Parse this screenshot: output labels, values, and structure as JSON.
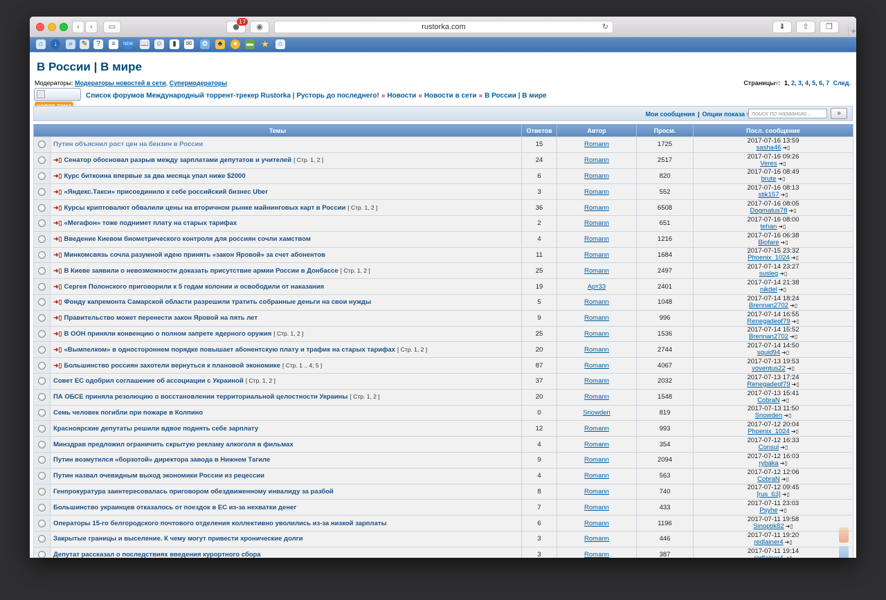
{
  "browser": {
    "url": "rustorka.com",
    "adblock_badge": "17"
  },
  "page": {
    "heading": "В России | В мире",
    "moderators_label": "Модераторы:",
    "moderators": [
      "Модераторы новостей в сети",
      "Супермодераторы"
    ],
    "pages_label": "Страницы",
    "pages": [
      "1",
      "2",
      "3",
      "4",
      "5",
      "6",
      "7"
    ],
    "pages_next": "След.",
    "new_topic_label": "новая тема",
    "breadcrumbs": [
      "Список форумов Международный торрент-трекер Rustorka | Русторь до последнего!",
      "Новости",
      "Новости в сети",
      "В России | В мире"
    ],
    "my_posts": "Мои сообщения",
    "view_options": "Опции показа",
    "search_placeholder": "поиск по названию...",
    "search_go": "»"
  },
  "table": {
    "headers": [
      "Темы",
      "Ответов",
      "Автор",
      "Просм.",
      "Посл. сообщение"
    ],
    "rows": [
      {
        "title": "Путин объяснил рост цен на бензин в России",
        "new": false,
        "read": true,
        "pages": "",
        "replies": "15",
        "author": "Romann",
        "views": "1725",
        "last_time": "2017-07-16 13:59",
        "last_user": "sasha46"
      },
      {
        "title": "Сенатор обосновал разрыв между зарплатами депутатов и учителей",
        "new": true,
        "read": false,
        "pages": "[ Стр. 1, 2 ]",
        "replies": "24",
        "author": "Romann",
        "views": "2517",
        "last_time": "2017-07-16 09:26",
        "last_user": "Veres"
      },
      {
        "title": "Курс биткоина впервые за два месяца упал ниже $2000",
        "new": true,
        "read": false,
        "pages": "",
        "replies": "6",
        "author": "Romann",
        "views": "820",
        "last_time": "2017-07-16 08:49",
        "last_user": "brute"
      },
      {
        "title": "«Яндекс.Такси» присоединило к себе российский бизнес Uber",
        "new": true,
        "read": false,
        "pages": "",
        "replies": "3",
        "author": "Romann",
        "views": "552",
        "last_time": "2017-07-16 08:13",
        "last_user": "stik157"
      },
      {
        "title": "Курсы криптовалют обвалили цены на вторичном рынке майнинговых карт в России",
        "new": true,
        "read": false,
        "pages": "[ Стр. 1, 2 ]",
        "replies": "36",
        "author": "Romann",
        "views": "6508",
        "last_time": "2017-07-16 08:05",
        "last_user": "Dogmatus78"
      },
      {
        "title": "«Мегафон» тоже поднимет плату на старых тарифах",
        "new": true,
        "read": false,
        "pages": "",
        "replies": "2",
        "author": "Romann",
        "views": "651",
        "last_time": "2017-07-16 08:00",
        "last_user": "tehan"
      },
      {
        "title": "Введение Киевом биометрического контроля для россиян сочли хамством",
        "new": true,
        "read": false,
        "pages": "",
        "replies": "4",
        "author": "Romann",
        "views": "1216",
        "last_time": "2017-07-16 06:38",
        "last_user": "Biofare"
      },
      {
        "title": "Минкомсвязь сочла разумной идею принять «закон Яровой» за счет абонентов",
        "new": true,
        "read": false,
        "pages": "",
        "replies": "11",
        "author": "Romann",
        "views": "1684",
        "last_time": "2017-07-15 23:32",
        "last_user": "Phoenix_1024"
      },
      {
        "title": "В Киеве заявили о невозможности доказать присутствие армии России в Донбассе",
        "new": true,
        "read": false,
        "pages": "[ Стр. 1, 2 ]",
        "replies": "25",
        "author": "Romann",
        "views": "2497",
        "last_time": "2017-07-14 23:27",
        "last_user": "susleg"
      },
      {
        "title": "Сергея Полонского приговорили к 5 годам колонии и освободили от наказания",
        "new": true,
        "read": false,
        "pages": "",
        "replies": "19",
        "author": "Арт33",
        "views": "2401",
        "last_time": "2017-07-14 21:38",
        "last_user": "nikdel"
      },
      {
        "title": "Фонду капремонта Самарской области разрешили тратить собранные деньги на свои нужды",
        "new": true,
        "read": false,
        "pages": "",
        "replies": "5",
        "author": "Romann",
        "views": "1048",
        "last_time": "2017-07-14 18:24",
        "last_user": "Brennan2702"
      },
      {
        "title": "Правительство может перенести закон Яровой на пять лет",
        "new": true,
        "read": false,
        "pages": "",
        "replies": "9",
        "author": "Romann",
        "views": "996",
        "last_time": "2017-07-14 16:55",
        "last_user": "Renegadeof79"
      },
      {
        "title": "В ООН приняли конвенцию о полном запрете ядерного оружия",
        "new": true,
        "read": false,
        "pages": "[ Стр. 1, 2 ]",
        "replies": "25",
        "author": "Romann",
        "views": "1536",
        "last_time": "2017-07-14 15:52",
        "last_user": "Brennan2702"
      },
      {
        "title": "«Вымпелком» в одностороннем порядке повышает абонентскую плату и трафик на старых тарифах",
        "new": true,
        "read": false,
        "pages": "[ Стр. 1, 2 ]",
        "replies": "20",
        "author": "Romann",
        "views": "2744",
        "last_time": "2017-07-14 14:50",
        "last_user": "squid94"
      },
      {
        "title": "Большинство россиян захотели вернуться к плановой экономике",
        "new": true,
        "read": false,
        "pages": "[ Стр. 1 .. 4, 5 ]",
        "replies": "87",
        "author": "Romann",
        "views": "4067",
        "last_time": "2017-07-13 19:53",
        "last_user": "voventus22"
      },
      {
        "title": "Совет ЕС одобрил соглашение об ассоциации с Украиной",
        "new": false,
        "read": false,
        "pages": "[ Стр. 1, 2 ]",
        "replies": "37",
        "author": "Romann",
        "views": "2032",
        "last_time": "2017-07-13 17:24",
        "last_user": "Renegadeof79"
      },
      {
        "title": "ПА ОБСЕ приняла резолюцию о восстановлении территориальной целостности Украины",
        "new": false,
        "read": false,
        "pages": "[ Стр. 1, 2 ]",
        "replies": "20",
        "author": "Romann",
        "views": "1548",
        "last_time": "2017-07-13 15:41",
        "last_user": "CobraN"
      },
      {
        "title": "Семь человек погибли при пожаре в Колпино",
        "new": false,
        "read": false,
        "pages": "",
        "replies": "0",
        "author": "Snowden",
        "views": "819",
        "last_time": "2017-07-13 11:50",
        "last_user": "Snowden"
      },
      {
        "title": "Красноярские депутаты решили вдвое поднять себе зарплату",
        "new": false,
        "read": false,
        "pages": "",
        "replies": "12",
        "author": "Romann",
        "views": "993",
        "last_time": "2017-07-12 20:04",
        "last_user": "Phoenix_1024"
      },
      {
        "title": "Минздрав предложил ограничить скрытую рекламу алкоголя в фильмах",
        "new": false,
        "read": false,
        "pages": "",
        "replies": "4",
        "author": "Romann",
        "views": "354",
        "last_time": "2017-07-12 16:33",
        "last_user": "Consul"
      },
      {
        "title": "Путин возмутился «борзотой» директора завода в Нижнем Тагиле",
        "new": false,
        "read": false,
        "pages": "",
        "replies": "9",
        "author": "Romann",
        "views": "2094",
        "last_time": "2017-07-12 16:03",
        "last_user": "rybaka"
      },
      {
        "title": "Путин назвал очевидным выход экономики России из рецессии",
        "new": false,
        "read": false,
        "pages": "",
        "replies": "4",
        "author": "Romann",
        "views": "563",
        "last_time": "2017-07-12 12:06",
        "last_user": "CobraN"
      },
      {
        "title": "Генпрокуратура заинтересовалась приговором обездвиженному инвалиду за разбой",
        "new": false,
        "read": false,
        "pages": "",
        "replies": "8",
        "author": "Romann",
        "views": "740",
        "last_time": "2017-07-12 09:45",
        "last_user": "[rus_63]"
      },
      {
        "title": "Большинство украинцев отказалось от поездок в ЕС из-за нехватки денег",
        "new": false,
        "read": false,
        "pages": "",
        "replies": "7",
        "author": "Romann",
        "views": "433",
        "last_time": "2017-07-11 23:03",
        "last_user": "Psyhe"
      },
      {
        "title": "Операторы 15-го белгородского почтового отделения коллективно уволились из-за низкой зарплаты",
        "new": false,
        "read": false,
        "pages": "",
        "replies": "6",
        "author": "Romann",
        "views": "1196",
        "last_time": "2017-07-11 19:58",
        "last_user": "Sinoptik82"
      },
      {
        "title": "Закрытые границы и выселение. К чему могут привести хронические долги",
        "new": false,
        "read": false,
        "pages": "",
        "replies": "3",
        "author": "Romann",
        "views": "446",
        "last_time": "2017-07-11 19:20",
        "last_user": "redlainer4"
      },
      {
        "title": "Депутат рассказал о последствиях введения курортного сбора",
        "new": false,
        "read": false,
        "pages": "",
        "replies": "3",
        "author": "Romann",
        "views": "387",
        "last_time": "2017-07-11 19:14",
        "last_user": "redlainer4"
      }
    ]
  },
  "icons": [
    "back-icon",
    "forward-icon",
    "sidebar-icon",
    "adblock-icon",
    "privacy-icon",
    "reload-icon",
    "download-icon",
    "share-icon",
    "tabs-icon",
    "new-tab-icon",
    "folder-icon",
    "new-post-arrow-icon",
    "goto-last-icon",
    "scroll-up-icon",
    "scroll-down-icon"
  ],
  "colors": {
    "accent": "#1a4f86",
    "header_bar": "#5d89bf",
    "favbar": "#4a7cb8"
  }
}
